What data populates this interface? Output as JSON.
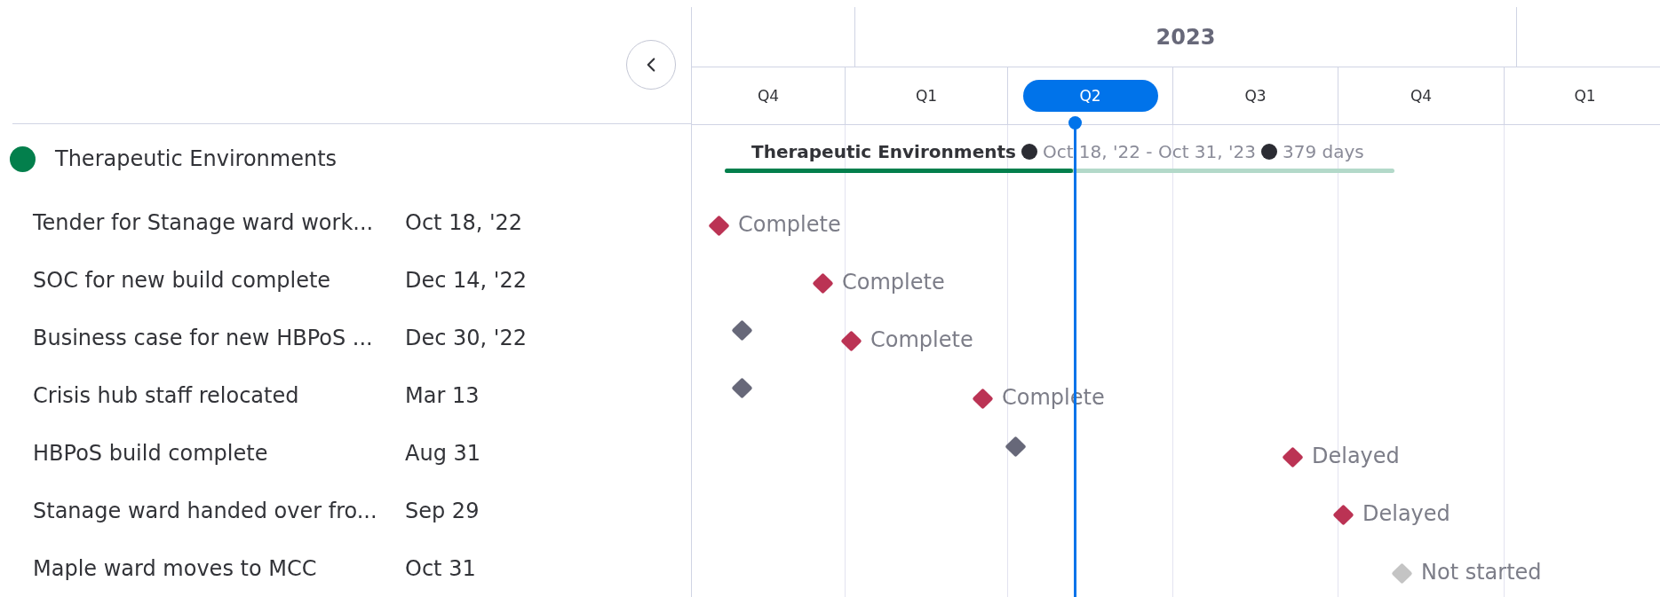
{
  "timeline": {
    "years": [
      {
        "label": "2023"
      }
    ],
    "quarters": [
      {
        "label": "Q4",
        "selected": false
      },
      {
        "label": "Q1",
        "selected": false
      },
      {
        "label": "Q2",
        "selected": true
      },
      {
        "label": "Q3",
        "selected": false
      },
      {
        "label": "Q4",
        "selected": false
      },
      {
        "label": "Q1",
        "selected": false
      }
    ]
  },
  "group": {
    "name": "Therapeutic Environments",
    "color": "#037f4c",
    "bar": {
      "label": "Therapeutic Environments",
      "dates": "Oct 18, '22 - Oct 31, '23",
      "duration": "379 days",
      "level": 0.52
    }
  },
  "tasks": [
    {
      "name": "Tender for Stanage ward work...",
      "date": "Oct 18, '22",
      "status": "Complete",
      "color": "#bb3354",
      "baseline": false
    },
    {
      "name": "SOC for new build complete",
      "date": "Dec 14, '22",
      "status": "Complete",
      "color": "#bb3354",
      "baseline": false
    },
    {
      "name": "Business case for new HBPoS ...",
      "date": "Dec 30, '22",
      "status": "Complete",
      "color": "#bb3354",
      "baseline": true
    },
    {
      "name": "Crisis hub staff relocated",
      "date": "Mar 13",
      "status": "Complete",
      "color": "#bb3354",
      "baseline": true
    },
    {
      "name": "HBPoS build complete",
      "date": "Aug 31",
      "status": "Delayed",
      "color": "#bb3354",
      "baseline": true
    },
    {
      "name": "Stanage ward handed over fro...",
      "date": "Sep 29",
      "status": "Delayed",
      "color": "#bb3354",
      "baseline": false
    },
    {
      "name": "Maple ward moves to MCC",
      "date": "Oct 31",
      "status": "Not started",
      "color": "#c4c4c4",
      "baseline": false
    }
  ]
}
